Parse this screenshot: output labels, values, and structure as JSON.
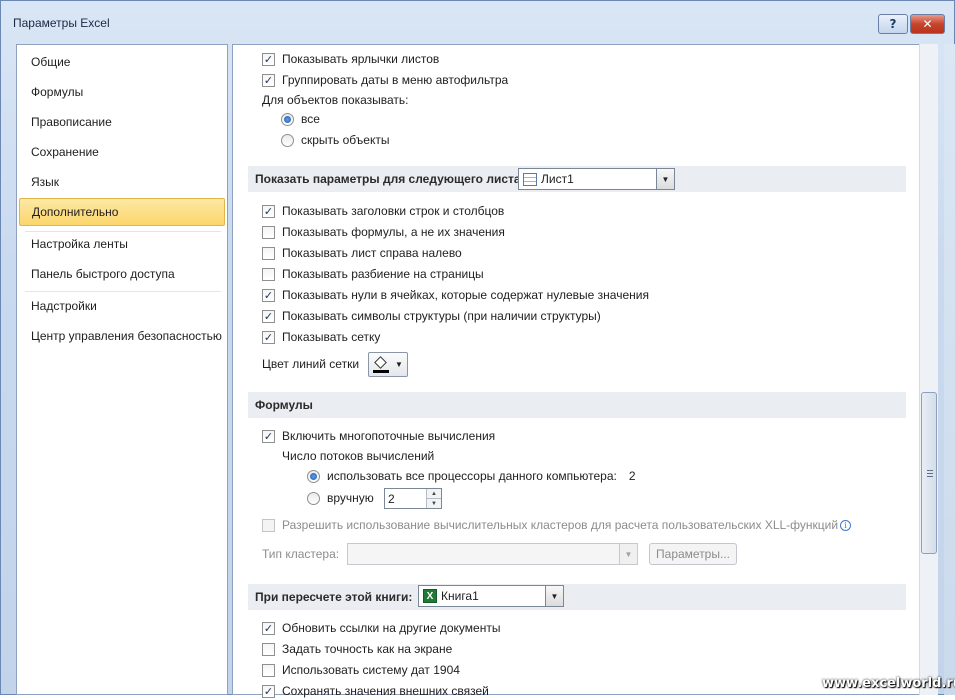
{
  "window": {
    "title": "Параметры Excel",
    "help_label": "?",
    "close_label": "✕"
  },
  "nav": {
    "items": [
      {
        "label": "Общие"
      },
      {
        "label": "Формулы"
      },
      {
        "label": "Правописание"
      },
      {
        "label": "Сохранение"
      },
      {
        "label": "Язык"
      },
      {
        "label": "Дополнительно",
        "active": true
      },
      {
        "label": "Настройка ленты"
      },
      {
        "label": "Панель быстрого доступа"
      },
      {
        "label": "Надстройки"
      },
      {
        "label": "Центр управления безопасностью"
      }
    ]
  },
  "book": {
    "show_sheet_tabs": {
      "label": "Показывать ярлычки листов",
      "checked": true
    },
    "group_dates": {
      "label": "Группировать даты в меню автофильтра",
      "checked": true
    },
    "objects_label": "Для объектов показывать:",
    "objects_all": {
      "label": "все",
      "selected": true
    },
    "objects_hide": {
      "label": "скрыть объекты",
      "selected": false
    }
  },
  "sheet_section": {
    "title": "Показать параметры для следующего листа:",
    "selected_sheet": "Лист1",
    "options": [
      {
        "label": "Показывать заголовки строк и столбцов",
        "checked": true
      },
      {
        "label": "Показывать формулы, а не их значения",
        "checked": false
      },
      {
        "label": "Показывать лист справа налево",
        "checked": false
      },
      {
        "label": "Показывать разбиение на страницы",
        "checked": false
      },
      {
        "label": "Показывать нули в ячейках, которые содержат нулевые значения",
        "checked": true
      },
      {
        "label": "Показывать символы структуры (при наличии структуры)",
        "checked": true
      },
      {
        "label": "Показывать сетку",
        "checked": true
      }
    ],
    "gridline_color_label": "Цвет линий сетки",
    "gridline_color": "#000000"
  },
  "formulas_section": {
    "title": "Формулы",
    "multithreaded": {
      "label": "Включить многопоточные вычисления",
      "checked": true
    },
    "threads_label": "Число потоков вычислений",
    "use_all": {
      "label": "использовать все процессоры данного компьютера:",
      "value": "2",
      "selected": true
    },
    "manual": {
      "label": "вручную",
      "value": "2",
      "selected": false
    },
    "clusters": {
      "label": "Разрешить использование вычислительных кластеров для расчета пользовательских XLL-функций",
      "checked": false
    },
    "cluster_type_label": "Тип кластера:",
    "cluster_type_value": "",
    "params_button": "Параметры..."
  },
  "recalc_section": {
    "title": "При пересчете этой книги:",
    "selected_book": "Книга1",
    "options": [
      {
        "label": "Обновить ссылки на другие документы",
        "checked": true
      },
      {
        "label": "Задать точность как на экране",
        "checked": false
      },
      {
        "label": "Использовать систему дат 1904",
        "checked": false
      },
      {
        "label": "Сохранять значения внешних связей",
        "checked": true
      }
    ]
  },
  "watermark": "www.excelworld.ru"
}
